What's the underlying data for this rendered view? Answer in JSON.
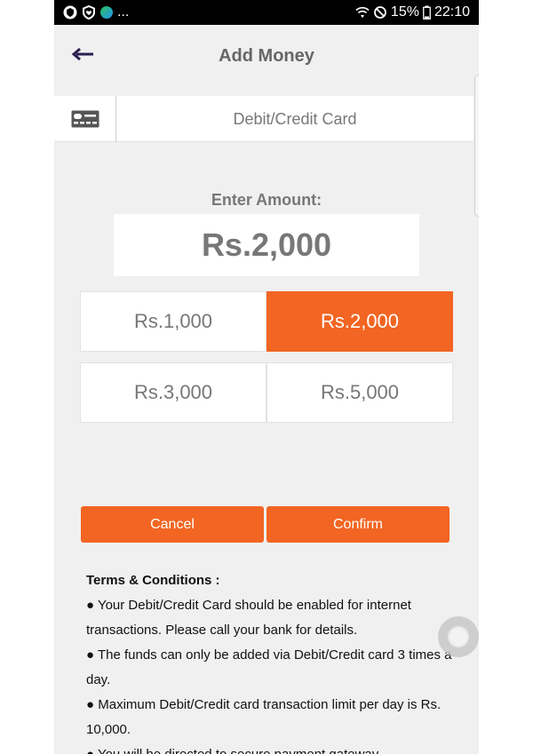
{
  "status_bar": {
    "left_icons": [
      "shield-icon",
      "shield-heart-icon",
      "app-dot-icon"
    ],
    "ellipsis": "...",
    "battery_percent": "15%",
    "time": "22:10"
  },
  "header": {
    "title": "Add Money"
  },
  "payment_method": {
    "label": "Debit/Credit Card",
    "icon": "card-icon"
  },
  "amount": {
    "label": "Enter Amount:",
    "value": "Rs.2,000"
  },
  "amount_options": [
    {
      "label": "Rs.1,000",
      "selected": false
    },
    {
      "label": "Rs.2,000",
      "selected": true
    },
    {
      "label": "Rs.3,000",
      "selected": false
    },
    {
      "label": "Rs.5,000",
      "selected": false
    }
  ],
  "actions": {
    "cancel_label": "Cancel",
    "confirm_label": "Confirm"
  },
  "terms": {
    "title": "Terms & Conditions :",
    "items": [
      "● Your Debit/Credit Card should be enabled for internet transactions. Please call your bank for details.",
      "● The funds can only be added via Debit/Credit card 3 times a day.",
      "● Maximum Debit/Credit card transaction limit per day is Rs. 10,000.",
      "● You will be directed to secure payment gateway."
    ]
  },
  "colors": {
    "accent": "#f26522",
    "background": "#f0f0f0",
    "text_muted": "#777777"
  }
}
